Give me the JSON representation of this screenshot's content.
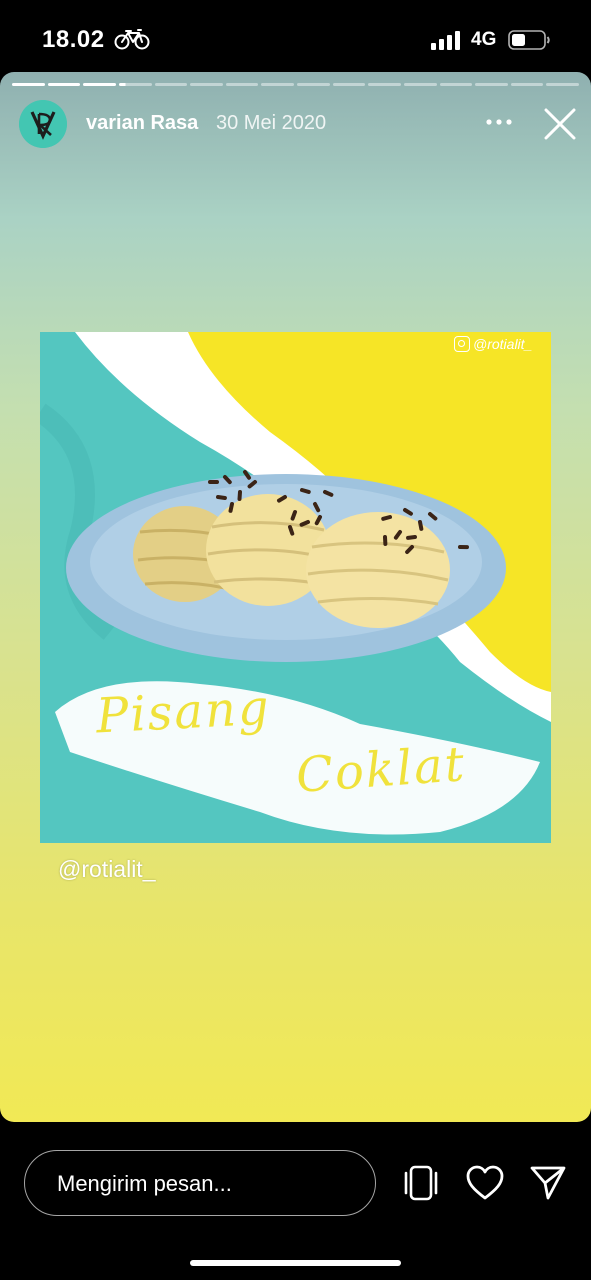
{
  "status_bar": {
    "time": "18.02",
    "network": "4G"
  },
  "story": {
    "progress_segments": 16,
    "progress_completed": 3,
    "username": "varian Rasa",
    "date": "30 Mei 2020",
    "avatar_text": "VR",
    "image": {
      "watermark": "@rotialit_",
      "title_line1": "Pisang",
      "title_line2": "Coklat"
    },
    "mention": "@rotialit_"
  },
  "reply": {
    "placeholder": "Mengirim pesan..."
  },
  "colors": {
    "teal": "#54c6c0",
    "yellow": "#f6e526",
    "plate": "#9fc3de",
    "bread": "#f2e19d",
    "title": "#f0e23c"
  }
}
